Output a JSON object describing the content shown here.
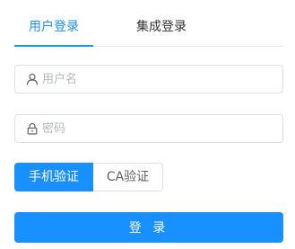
{
  "tabs": {
    "active_label": "用户登录",
    "inactive_label": "集成登录"
  },
  "username": {
    "placeholder": "用户名",
    "value": "",
    "icon": "user-icon"
  },
  "password": {
    "placeholder": "密码",
    "value": "",
    "icon": "lock-icon"
  },
  "verify_mode": {
    "options": [
      "手机验证",
      "CA验证"
    ],
    "selected": "手机验证"
  },
  "submit_label": "登 录",
  "colors": {
    "primary": "#1890ff",
    "border": "#dcdfe6",
    "placeholder": "#b4b8bf"
  }
}
